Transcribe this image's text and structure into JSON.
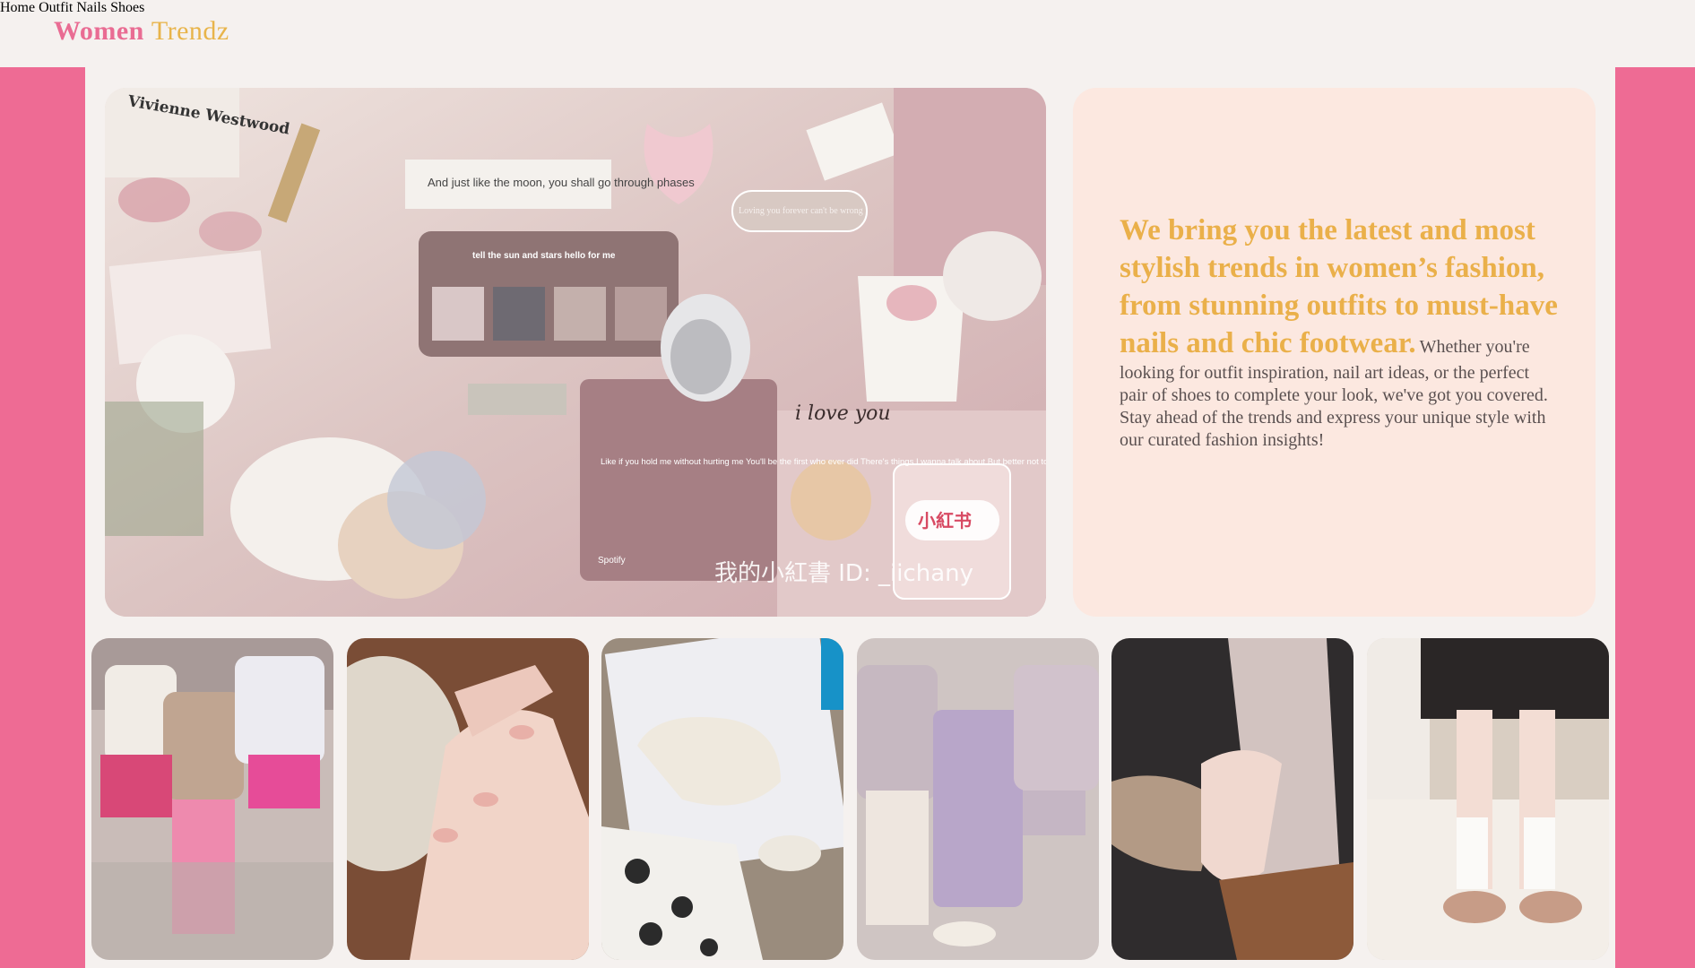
{
  "header": {
    "logo_word1": "Women",
    "logo_word2": "Trendz",
    "nav": [
      "Home",
      "Outfit",
      "Nails",
      "Shoes"
    ]
  },
  "hero": {
    "sticker_vw": "Vivienne Westwood",
    "sticker_moon": "And just like the moon, you shall go through phases",
    "sticker_music": "tell the sun and stars hello for me",
    "sticker_loving": "Loving you forever can't be wrong",
    "sticker_lyrics": "Like if you hold me without hurting me You'll be the first who ever did There's things I wanna talk about But better not to give",
    "sticker_spotify": "Spotify",
    "sticker_iloveyou": "i love you",
    "sticker_xhs": "小紅书",
    "watermark": "我的小紅書 ID: _iichany"
  },
  "card": {
    "headline": "We bring you the latest and most stylish trends in women’s fashion, from stunning outfits to must-have nails and chic footwear.",
    "body": "Whether you're looking for outfit inspiration, nail art ideas, or the perfect pair of shoes to complete your look, we've got you covered. Stay ahead of the trends and express your unique style with our curated fashion insights!"
  },
  "colors": {
    "brand_pink": "#e96c93",
    "brand_gold": "#e8b44a",
    "side_pink": "#ee6b94",
    "card_bg": "#fce8e0",
    "page_bg": "#f5f1ef"
  },
  "thumbnails": [
    {
      "subject": "outfit-photo"
    },
    {
      "subject": "nails-photo"
    },
    {
      "subject": "shoes-photo"
    },
    {
      "subject": "outfit-photo"
    },
    {
      "subject": "nails-photo"
    },
    {
      "subject": "shoes-photo"
    }
  ]
}
